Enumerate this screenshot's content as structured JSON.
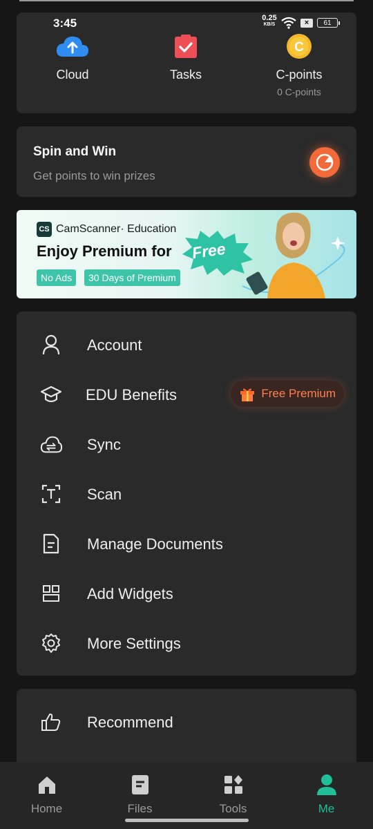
{
  "status_bar": {
    "time": "3:45",
    "net_speed": "0.25",
    "net_unit": "KB/S",
    "battery": "61"
  },
  "quick_tiles": [
    {
      "label": "Cloud",
      "sub": ""
    },
    {
      "label": "Tasks",
      "sub": ""
    },
    {
      "label": "C-points",
      "sub": "0 C-points"
    }
  ],
  "spin": {
    "title": "Spin and Win",
    "subtitle": "Get points to win prizes"
  },
  "banner": {
    "logo": "CS",
    "brand": "CamScanner· Education",
    "headline": "Enjoy Premium for",
    "free": "Free",
    "tags": [
      "No Ads",
      "30 Days of Premium"
    ]
  },
  "menu": [
    {
      "label": "Account",
      "icon": "user-icon"
    },
    {
      "label": "EDU Benefits",
      "icon": "graduation-cap-icon",
      "badge": "Free Premium"
    },
    {
      "label": "Sync",
      "icon": "cloud-sync-icon"
    },
    {
      "label": "Scan",
      "icon": "scan-text-icon"
    },
    {
      "label": "Manage Documents",
      "icon": "document-icon"
    },
    {
      "label": "Add Widgets",
      "icon": "widgets-icon"
    },
    {
      "label": "More Settings",
      "icon": "gear-icon"
    }
  ],
  "menu2": [
    {
      "label": "Recommend",
      "icon": "thumbs-up-icon"
    }
  ],
  "tabs": [
    {
      "label": "Home",
      "icon": "home-icon",
      "active": false
    },
    {
      "label": "Files",
      "icon": "files-icon",
      "active": false
    },
    {
      "label": "Tools",
      "icon": "tools-icon",
      "active": false
    },
    {
      "label": "Me",
      "icon": "person-icon",
      "active": true
    }
  ],
  "colors": {
    "accent": "#1fbf97",
    "orange": "#f26a3a",
    "card": "#2a2a2a",
    "background": "#161616"
  }
}
